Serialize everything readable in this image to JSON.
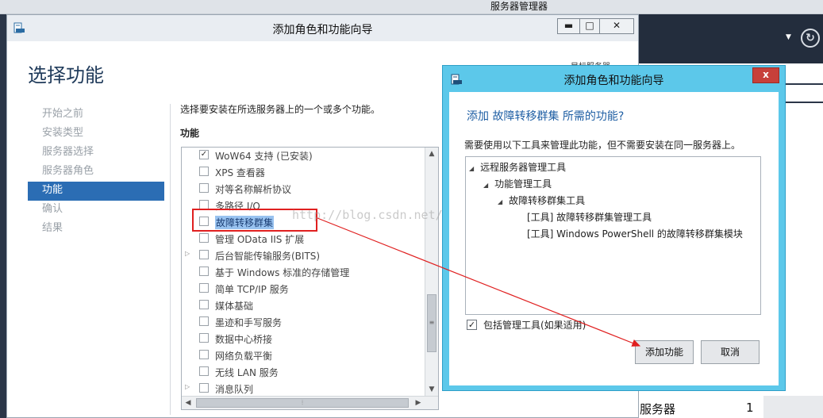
{
  "server_manager": {
    "title": "服务器管理器",
    "bottom_label": "服务器",
    "bottom_count": "1"
  },
  "wizard": {
    "title": "添加角色和功能向导",
    "heading": "选择功能",
    "target_server": "目标服务器",
    "description": "选择要安装在所选服务器上的一个或多个功能。",
    "features_label": "功能",
    "nav": [
      "开始之前",
      "安装类型",
      "服务器选择",
      "服务器角色",
      "功能",
      "确认",
      "结果"
    ],
    "features": [
      {
        "label": "WoW64 支持 (已安装)",
        "checked": true,
        "expandable": false
      },
      {
        "label": "XPS 查看器",
        "checked": false,
        "expandable": false
      },
      {
        "label": "对等名称解析协议",
        "checked": false,
        "expandable": false
      },
      {
        "label": "多路径 I/O",
        "checked": false,
        "expandable": false
      },
      {
        "label": "故障转移群集",
        "checked": false,
        "expandable": false,
        "selected": true
      },
      {
        "label": "管理 OData IIS 扩展",
        "checked": false,
        "expandable": false
      },
      {
        "label": "后台智能传输服务(BITS)",
        "checked": false,
        "expandable": true
      },
      {
        "label": "基于 Windows 标准的存储管理",
        "checked": false,
        "expandable": false
      },
      {
        "label": "简单 TCP/IP 服务",
        "checked": false,
        "expandable": false
      },
      {
        "label": "媒体基础",
        "checked": false,
        "expandable": false
      },
      {
        "label": "墨迹和手写服务",
        "checked": false,
        "expandable": false
      },
      {
        "label": "数据中心桥接",
        "checked": false,
        "expandable": false
      },
      {
        "label": "网络负载平衡",
        "checked": false,
        "expandable": false
      },
      {
        "label": "无线 LAN 服务",
        "checked": false,
        "expandable": false
      },
      {
        "label": "消息队列",
        "checked": false,
        "expandable": true
      }
    ],
    "window_buttons": {
      "minimize": "▬",
      "maximize": "□",
      "close": "✕"
    }
  },
  "watermark": "http://blog.csdn.net/DBA_Huang",
  "dialog": {
    "title": "添加角色和功能向导",
    "close": "x",
    "question": "添加 故障转移群集 所需的功能?",
    "info": "需要使用以下工具来管理此功能，但不需要安装在同一服务器上。",
    "tree": [
      {
        "label": "远程服务器管理工具",
        "level": 0,
        "expander": "◢"
      },
      {
        "label": "功能管理工具",
        "level": 1,
        "expander": "◢"
      },
      {
        "label": "故障转移群集工具",
        "level": 2,
        "expander": "◢"
      },
      {
        "label": "[工具] 故障转移群集管理工具",
        "level": 3,
        "expander": ""
      },
      {
        "label": "[工具] Windows PowerShell 的故障转移群集模块",
        "level": 3,
        "expander": ""
      }
    ],
    "include_tools_label": "包括管理工具(如果适用)",
    "include_tools_checked": true,
    "add_button": "添加功能",
    "cancel_button": "取消"
  },
  "colors": {
    "accent": "#2b6db4",
    "dialog_frame": "#5cc8ea",
    "highlight": "#e02020",
    "question": "#1f5fa4"
  }
}
